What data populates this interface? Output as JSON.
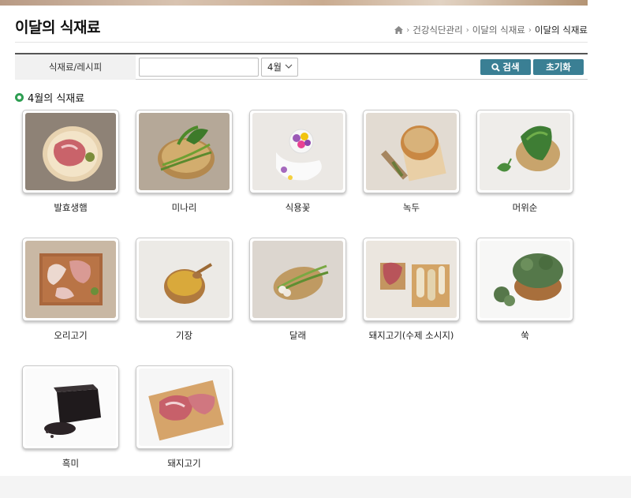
{
  "page": {
    "title": "이달의 식재료",
    "breadcrumb": [
      "건강식단관리",
      "이달의 식재료",
      "이달의 식재료"
    ]
  },
  "search": {
    "label": "식재료/레시피",
    "input_value": "",
    "input_placeholder": "",
    "month_selected": "4월",
    "search_button": "검색",
    "reset_button": "초기화"
  },
  "section": {
    "title": "4월의 식재료"
  },
  "ingredients": [
    {
      "name": "발효생햄"
    },
    {
      "name": "미나리"
    },
    {
      "name": "식용꽃"
    },
    {
      "name": "녹두"
    },
    {
      "name": "머위순"
    },
    {
      "name": "오리고기"
    },
    {
      "name": "기장"
    },
    {
      "name": "달래"
    },
    {
      "name": "돼지고기(수제 소시지)"
    },
    {
      "name": "쑥"
    },
    {
      "name": "흑미"
    },
    {
      "name": "돼지고기"
    }
  ],
  "colors": {
    "accent": "#3a7f94",
    "bullet": "#2e9e52",
    "header_rule": "#555555"
  },
  "icons": {
    "home": "home-icon",
    "chevron": "chevron-down-icon",
    "search": "search-icon",
    "separator": "chevron-right-icon"
  }
}
